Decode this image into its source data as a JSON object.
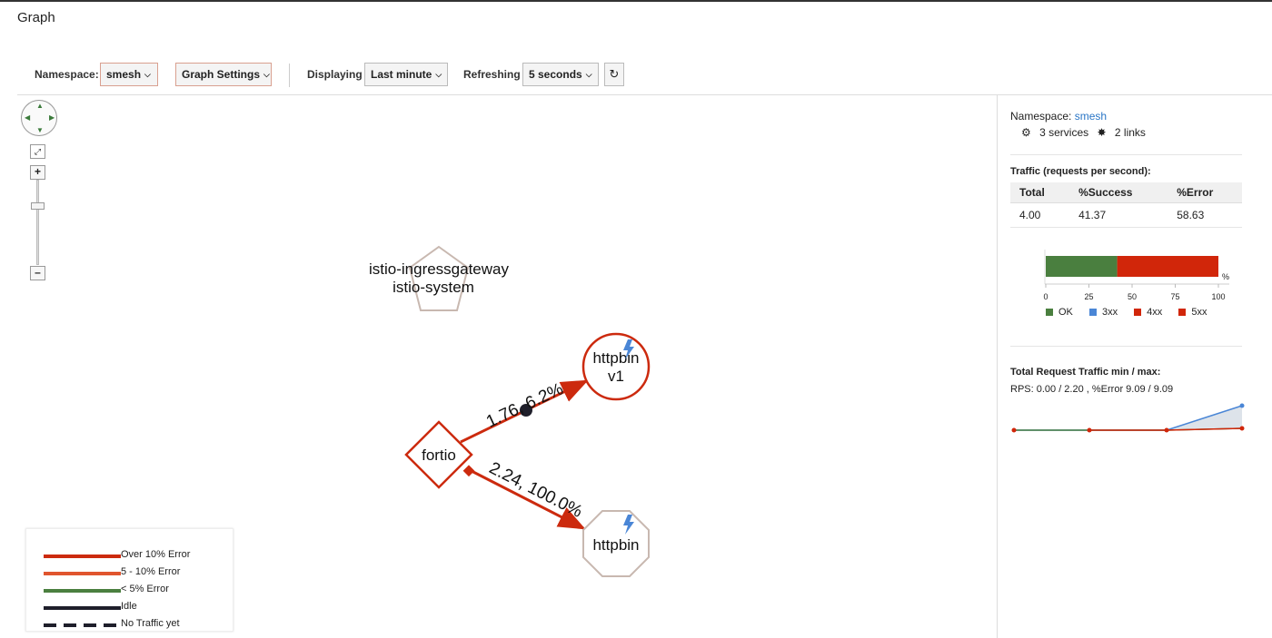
{
  "page": {
    "title": "Graph"
  },
  "toolbar": {
    "namespace_label": "Namespace:",
    "namespace_value": "smesh",
    "graph_settings": "Graph Settings",
    "displaying_label": "Displaying",
    "displaying_value": "Last minute",
    "refreshing_label": "Refreshing",
    "refreshing_value": "5 seconds"
  },
  "graph": {
    "nodes": [
      {
        "id": "gateway",
        "label1": "istio-ingressgateway",
        "label2": "istio-system"
      },
      {
        "id": "httpbin-v1",
        "label1": "httpbin",
        "label2": "v1"
      },
      {
        "id": "fortio",
        "label1": "fortio"
      },
      {
        "id": "httpbin",
        "label1": "httpbin"
      }
    ],
    "edges": [
      {
        "from": "fortio",
        "to": "httpbin-v1",
        "label": "1.76, 6.2%"
      },
      {
        "from": "fortio",
        "to": "httpbin",
        "label": "2.24, 100.0%"
      }
    ]
  },
  "legend": [
    {
      "label": "Over 10% Error",
      "color": "#cc2a0e",
      "style": "solid"
    },
    {
      "label": "5 - 10% Error",
      "color": "#e0552e",
      "style": "solid"
    },
    {
      "label": "< 5% Error",
      "color": "#4a7f3f",
      "style": "solid"
    },
    {
      "label": "Idle",
      "color": "#1f1f2b",
      "style": "solid"
    },
    {
      "label": "No Traffic yet",
      "color": "#1f1f2b",
      "style": "dashed"
    }
  ],
  "side_panel": {
    "namespace_label": "Namespace:",
    "namespace_value": "smesh",
    "services": "3 services",
    "links": "2 links",
    "traffic_title": "Traffic (requests per second):",
    "table": {
      "headers": [
        "Total",
        "%Success",
        "%Error"
      ],
      "values": [
        "4.00",
        "41.37",
        "58.63"
      ]
    },
    "bar_chart": {
      "ok_percent": 41.37,
      "error_5xx_percent": 58.63,
      "ticks": [
        "0",
        "25",
        "50",
        "75",
        "100"
      ],
      "unit": "%",
      "legend": [
        {
          "label": "OK",
          "color": "#4a7f3f"
        },
        {
          "label": "3xx",
          "color": "#4a86d6"
        },
        {
          "label": "4xx",
          "color": "#d1260a"
        },
        {
          "label": "5xx",
          "color": "#d1260a"
        }
      ]
    },
    "total_title": "Total Request Traffic min / max:",
    "rps_line": "RPS: 0.00 / 2.20 , %Error 9.09 / 9.09"
  }
}
